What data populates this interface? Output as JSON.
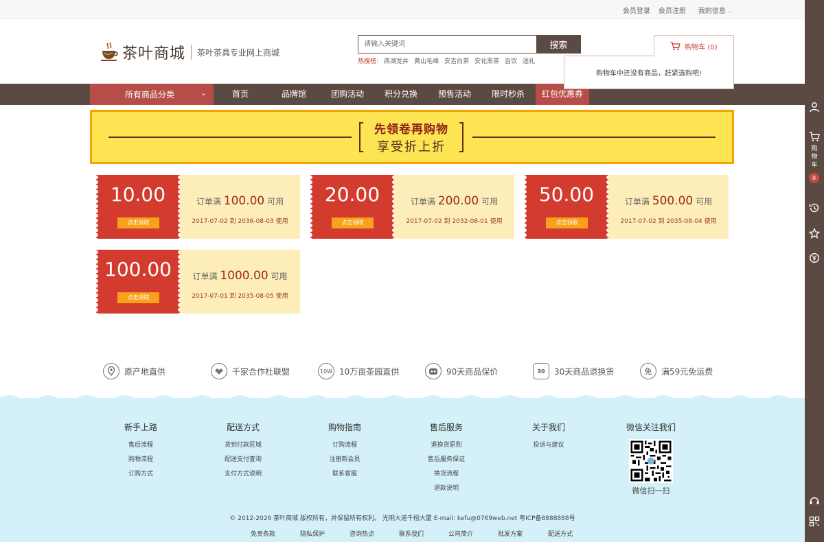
{
  "topbar": {
    "login": "会员登录",
    "register": "会员注册",
    "my_info": "我的信息"
  },
  "logo": {
    "name": "茶叶商城",
    "slogan": "茶叶茶具专业网上商城"
  },
  "search": {
    "placeholder": "请输入关键词",
    "button": "搜索",
    "hot_label": "热搜榜:",
    "hot_words": [
      "西湖龙井",
      "黄山毛峰",
      "安吉白茶",
      "安化黑茶",
      "自饮",
      "送礼"
    ]
  },
  "cart": {
    "label": "购物车 (0)",
    "empty_msg": "购物车中还没有商品，赶紧选购吧!"
  },
  "nav": {
    "category": "所有商品分类",
    "items": [
      "首页",
      "品牌馆",
      "团购活动",
      "积分兑换",
      "预售活动",
      "限时秒杀",
      "红包优惠券"
    ]
  },
  "banner": {
    "line1": "先领卷再购物",
    "line2": "享受折上折"
  },
  "coupons": [
    {
      "amount": "10.00",
      "button": "点击领取",
      "cond_prefix": "订单满",
      "cond_value": "100.00",
      "cond_suffix": "可用",
      "date": "2017-07-02 到 2036-08-03 使用"
    },
    {
      "amount": "20.00",
      "button": "点击领取",
      "cond_prefix": "订单满",
      "cond_value": "200.00",
      "cond_suffix": "可用",
      "date": "2017-07-02 到 2032-08-01 使用"
    },
    {
      "amount": "50.00",
      "button": "点击领取",
      "cond_prefix": "订单满",
      "cond_value": "500.00",
      "cond_suffix": "可用",
      "date": "2017-07-02 到 2035-08-04 使用"
    },
    {
      "amount": "100.00",
      "button": "点击领取",
      "cond_prefix": "订单满",
      "cond_value": "1000.00",
      "cond_suffix": "可用",
      "date": "2017-07-01 到 2035-08-05 使用"
    }
  ],
  "services": [
    {
      "icon": "location-pin-icon",
      "glyph": "",
      "label": "原产地直供"
    },
    {
      "icon": "handshake-icon",
      "glyph": "",
      "label": "千家合作社联盟"
    },
    {
      "icon": "10w-icon",
      "glyph": "10W",
      "label": "10万亩茶园直供"
    },
    {
      "icon": "guarantee-icon",
      "glyph": "",
      "label": "90天商品保价"
    },
    {
      "icon": "calendar-30-icon",
      "glyph": "30",
      "label": "30天商品退换货"
    },
    {
      "icon": "free-shipping-icon",
      "glyph": "免",
      "label": "满59元免运费"
    }
  ],
  "footer": {
    "columns": [
      {
        "title": "新手上路",
        "links": [
          "售后流程",
          "购物流程",
          "订购方式"
        ]
      },
      {
        "title": "配送方式",
        "links": [
          "货到付款区域",
          "配送支付查询",
          "支付方式说明"
        ]
      },
      {
        "title": "购物指南",
        "links": [
          "订购流程",
          "注册新会员",
          "联系客服"
        ]
      },
      {
        "title": "售后服务",
        "links": [
          "退换货原则",
          "售后服务保证",
          "换货流程",
          "退款说明"
        ]
      },
      {
        "title": "关于我们",
        "links": [
          "投诉与建议"
        ]
      }
    ],
    "wechat_title": "微信关注我们",
    "wechat_caption": "微信扫一扫",
    "copyright": "© 2012-2026 茶叶商城 版权所有，并保留所有权利。 光明大道千栩大厦 E-mail: kefu@0769web.net 粤ICP备8888888号",
    "bottom_links": [
      "免责条款",
      "隐私保护",
      "咨询热点",
      "联系我们",
      "公司简介",
      "批发方案",
      "配送方式"
    ]
  },
  "sidebar": {
    "cart_label": "购物车",
    "cart_count": "0"
  },
  "colors": {
    "brown": "#5b4a42",
    "red": "#b64d48",
    "coupon_red": "#d33b2f",
    "coupon_cream": "#fdedb9",
    "banner_yellow": "#fde453",
    "footer_blue": "#d4f1f9"
  }
}
